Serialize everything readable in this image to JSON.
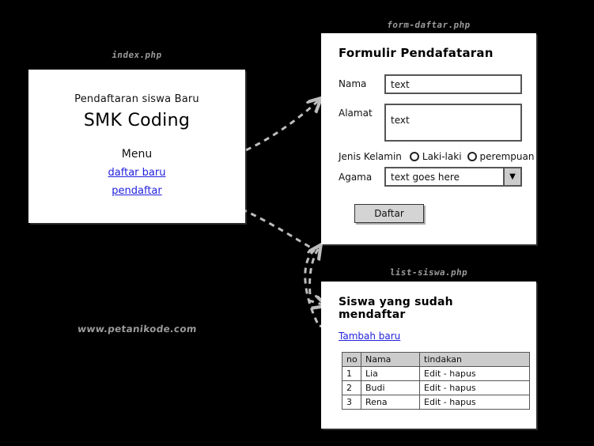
{
  "diagram": {
    "watermark": "www.petanikode.com",
    "arrow_color": "#b9b9b9",
    "background": "#000000",
    "panel_background": "#ffffff",
    "link_color": "#2222dd",
    "title_color": "#9a9a9a"
  },
  "panels": {
    "index": {
      "title": "index.php",
      "subtitle": "Pendaftaran siswa Baru",
      "heading": "SMK Coding",
      "menu_label": "Menu",
      "links": [
        {
          "label": "daftar baru"
        },
        {
          "label": "pendaftar"
        }
      ]
    },
    "form": {
      "title": "form-daftar.php",
      "heading": "Formulir Pendafataran",
      "fields": [
        {
          "label": "Nama",
          "value": "text",
          "type": "text"
        },
        {
          "label": "Alamat",
          "value": "text",
          "type": "textarea"
        }
      ],
      "gender": {
        "legend": "Jenis Kelamin",
        "options": [
          {
            "label": "Laki-laki",
            "selected": false
          },
          {
            "label": "perempuan",
            "selected": false
          }
        ]
      },
      "religion": {
        "label": "Agama",
        "value": "text goes here",
        "arrow_icon": "chevron-down-icon"
      },
      "submit_label": "Daftar"
    },
    "list": {
      "title": "list-siswa.php",
      "heading": "Siswa yang sudah mendaftar",
      "add_link": "Tambah baru",
      "table": {
        "headers": [
          "no",
          "Nama",
          "tindakan"
        ],
        "rows": [
          [
            "1",
            "Lia",
            "Edit - hapus"
          ],
          [
            "2",
            "Budi",
            "Edit - hapus"
          ],
          [
            "3",
            "Rena",
            "Edit - hapus"
          ]
        ]
      }
    }
  }
}
